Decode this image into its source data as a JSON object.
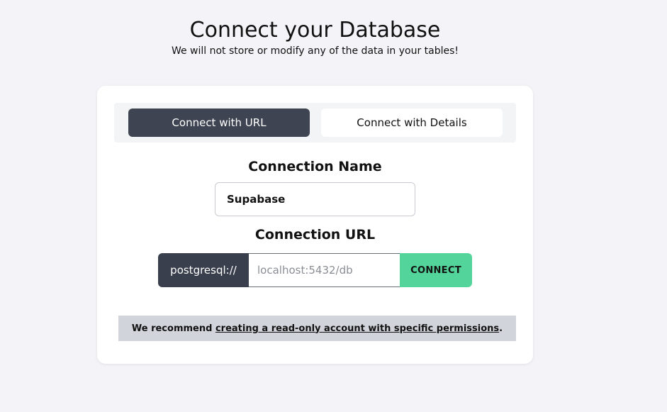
{
  "header": {
    "title": "Connect your Database",
    "subtitle": "We will not store or modify any of the data in your tables!"
  },
  "tabs": [
    {
      "label": "Connect with URL",
      "active": true
    },
    {
      "label": "Connect with Details",
      "active": false
    }
  ],
  "form": {
    "name_label": "Connection Name",
    "name_value": "Supabase",
    "url_label": "Connection URL",
    "url_prefix": "postgresql://",
    "url_placeholder": "localhost:5432/db",
    "connect_label": "CONNECT"
  },
  "notice": {
    "prefix": "We recommend ",
    "link_text": "creating a read-only account with specific permissions",
    "suffix": "."
  },
  "colors": {
    "active_tab": "#3f4452",
    "connect_button": "#52d49a",
    "notice_bg": "#d1d5db"
  }
}
